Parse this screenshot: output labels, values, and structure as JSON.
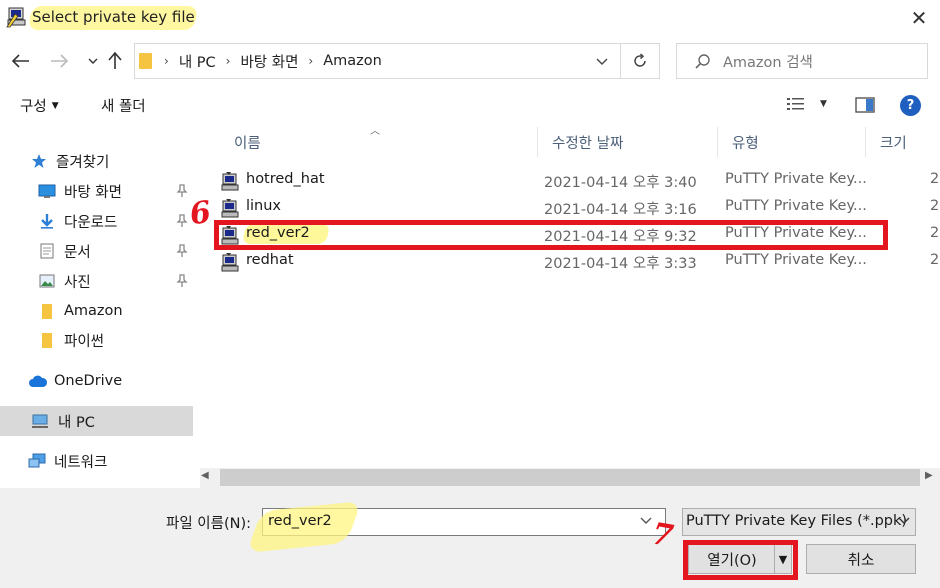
{
  "window": {
    "title": "Select private key file",
    "close_glyph": "✕"
  },
  "address": {
    "crumbs": [
      "내 PC",
      "바탕 화면",
      "Amazon"
    ],
    "search_placeholder": "Amazon 검색"
  },
  "toolbar": {
    "organize_label": "구성",
    "new_folder_label": "새 폴더",
    "help_glyph": "?"
  },
  "sidebar": {
    "items": [
      {
        "label": "즐겨찾기",
        "icon": "star-icon"
      },
      {
        "label": "바탕 화면",
        "icon": "desktop-icon"
      },
      {
        "label": "다운로드",
        "icon": "download-icon"
      },
      {
        "label": "문서",
        "icon": "document-icon"
      },
      {
        "label": "사진",
        "icon": "pictures-icon"
      },
      {
        "label": "Amazon",
        "icon": "folder-icon"
      },
      {
        "label": "파이썬",
        "icon": "folder-icon"
      },
      {
        "label": "OneDrive",
        "icon": "cloud-icon"
      },
      {
        "label": "내 PC",
        "icon": "computer-icon"
      },
      {
        "label": "네트워크",
        "icon": "network-icon"
      }
    ]
  },
  "columns": {
    "name": "이름",
    "modified": "수정한 날짜",
    "type": "유형",
    "size": "크기"
  },
  "files": [
    {
      "name": "hotred_hat",
      "modified": "2021-04-14 오후 3:40",
      "type": "PuTTY Private Key...",
      "size": "2"
    },
    {
      "name": "linux",
      "modified": "2021-04-14 오후 3:16",
      "type": "PuTTY Private Key...",
      "size": "2"
    },
    {
      "name": "red_ver2",
      "modified": "2021-04-14 오후 9:32",
      "type": "PuTTY Private Key...",
      "size": "2"
    },
    {
      "name": "redhat",
      "modified": "2021-04-14 오후 3:33",
      "type": "PuTTY Private Key...",
      "size": "2"
    }
  ],
  "annotations": {
    "step_six": "6",
    "step_seven": "7",
    "highlight_color": "#e3151e"
  },
  "bottom": {
    "filename_label": "파일 이름(N):",
    "filename_value": "red_ver2",
    "filter_value": "PuTTY Private Key Files (*.ppk)",
    "open_label": "열기(O)",
    "cancel_label": "취소"
  }
}
